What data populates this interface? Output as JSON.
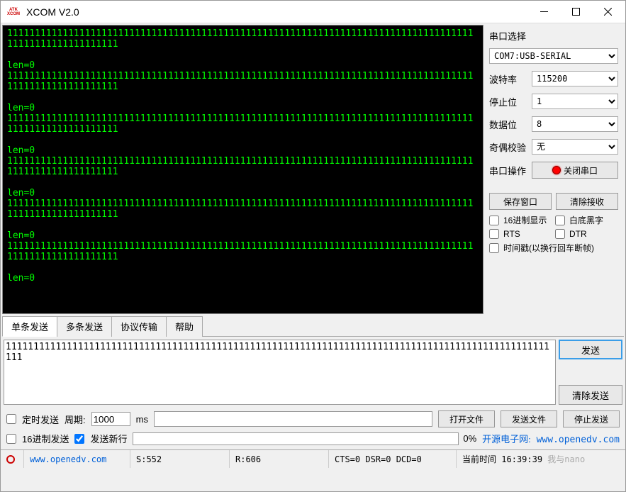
{
  "window": {
    "logo_top": "ATK",
    "logo_bottom": "XCOM",
    "title": "XCOM V2.0"
  },
  "terminal_lines": [
    "11111111111111111111111111111111111111111111111111111111111111111111111111111111111111111111111111111111",
    "",
    "len=0",
    "11111111111111111111111111111111111111111111111111111111111111111111111111111111111111111111111111111111",
    "",
    "len=0",
    "11111111111111111111111111111111111111111111111111111111111111111111111111111111111111111111111111111111",
    "",
    "len=0",
    "11111111111111111111111111111111111111111111111111111111111111111111111111111111111111111111111111111111",
    "",
    "len=0",
    "11111111111111111111111111111111111111111111111111111111111111111111111111111111111111111111111111111111",
    "",
    "len=0",
    "11111111111111111111111111111111111111111111111111111111111111111111111111111111111111111111111111111111",
    "",
    "len=0"
  ],
  "side": {
    "section": "串口选择",
    "port": "COM7:USB-SERIAL",
    "baud_label": "波特率",
    "baud": "115200",
    "stop_label": "停止位",
    "stop": "1",
    "data_label": "数据位",
    "data": "8",
    "parity_label": "奇偶校验",
    "parity": "无",
    "op_label": "串口操作",
    "op_btn": "关闭串口",
    "save_btn": "保存窗口",
    "clear_btn": "清除接收",
    "hex_disp": "16进制显示",
    "white_bg": "白底黑字",
    "rts": "RTS",
    "dtr": "DTR",
    "timestamp": "时间戳(以换行回车断帧)"
  },
  "tabs": {
    "single": "单条发送",
    "multi": "多条发送",
    "proto": "协议传输",
    "help": "帮助"
  },
  "send": {
    "content": "11111111111111111111111111111111111111111111111111111111111111111111111111111111111111111111111111111",
    "send_btn": "发送",
    "clear_btn": "清除发送"
  },
  "opts": {
    "timed": "定时发送",
    "period_label": "周期:",
    "period_val": "1000",
    "period_unit": "ms",
    "open_file": "打开文件",
    "send_file": "发送文件",
    "stop_send": "停止发送",
    "hex_send": "16进制发送",
    "send_newline": "发送新行",
    "progress": "0%",
    "link_cn": "开源电子网:",
    "link_url": "www.openedv.com"
  },
  "status": {
    "url": "www.openedv.com",
    "s": "S:552",
    "r": "R:606",
    "sig": "CTS=0 DSR=0 DCD=0",
    "time_label": "当前时间",
    "time_val": "16:39:39",
    "watermark": "我与nano"
  }
}
